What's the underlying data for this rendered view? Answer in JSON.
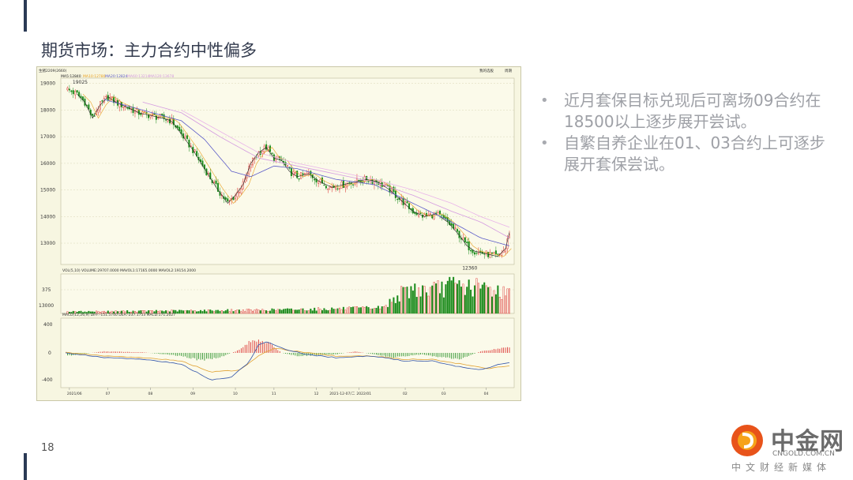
{
  "slide": {
    "title": "期货市场：主力合约中性偏多",
    "page_number": "18",
    "bullets": [
      "近月套保目标兑现后可离场09合约在18500以上逐步展开尝试。",
      "自繁自养企业在01、03合约上可逐步展开套保尝试。"
    ]
  },
  "logo": {
    "name": "中金网",
    "url": "CNGOLD.COM.CN",
    "tagline": "中文财经新媒体"
  },
  "colors": {
    "up": "#d92121",
    "down": "#1a8a1a",
    "ma5": "#222222",
    "ma10": "#e8a020",
    "ma20": "#5b5bc8",
    "ma60": "#d49be0",
    "dif": "#3355aa",
    "dea": "#e0a030"
  },
  "chart_data": [
    {
      "type": "candlestick",
      "header": "生猪2209(2660)",
      "legend": [
        "MA5:12840",
        "MA10:12780",
        "MA20:12824",
        "MA60:13214",
        "MA120:13678"
      ],
      "top_right_labels": [
        "我的选股",
        "周期"
      ],
      "ylim": [
        12200,
        19200
      ],
      "y_ticks": [
        "19000",
        "18000",
        "17000",
        "16000",
        "15000",
        "14000",
        "13000"
      ],
      "annotations": {
        "high": "19025",
        "low": "12360"
      },
      "x_ticks": [
        "2021/06",
        "07",
        "08",
        "09",
        "10",
        "11",
        "12",
        "2021-12-07/二",
        "2022/01",
        "02",
        "03",
        "04"
      ],
      "close_path": [
        [
          0,
          18800
        ],
        [
          6,
          18600
        ],
        [
          10,
          18300
        ],
        [
          14,
          17700
        ],
        [
          18,
          18200
        ],
        [
          22,
          18500
        ],
        [
          26,
          18300
        ],
        [
          32,
          18100
        ],
        [
          38,
          17900
        ],
        [
          44,
          17800
        ],
        [
          50,
          17700
        ],
        [
          55,
          17600
        ],
        [
          60,
          17100
        ],
        [
          66,
          16500
        ],
        [
          72,
          15800
        ],
        [
          78,
          15100
        ],
        [
          84,
          14500
        ],
        [
          88,
          14800
        ],
        [
          92,
          15200
        ],
        [
          96,
          16000
        ],
        [
          100,
          16400
        ],
        [
          104,
          16600
        ],
        [
          108,
          16200
        ],
        [
          112,
          16100
        ],
        [
          116,
          15700
        ],
        [
          120,
          15500
        ],
        [
          126,
          15600
        ],
        [
          132,
          15300
        ],
        [
          138,
          15100
        ],
        [
          144,
          15200
        ],
        [
          150,
          15300
        ],
        [
          156,
          15400
        ],
        [
          162,
          15300
        ],
        [
          168,
          15000
        ],
        [
          174,
          14600
        ],
        [
          180,
          14200
        ],
        [
          186,
          14000
        ],
        [
          192,
          14100
        ],
        [
          198,
          13800
        ],
        [
          204,
          13300
        ],
        [
          208,
          12900
        ],
        [
          212,
          12700
        ],
        [
          218,
          12600
        ],
        [
          224,
          12500
        ],
        [
          228,
          12800
        ],
        [
          230,
          13400
        ]
      ],
      "ma_paths": {
        "ma20": [
          [
            20,
            18400
          ],
          [
            40,
            18000
          ],
          [
            60,
            17600
          ],
          [
            72,
            16900
          ],
          [
            86,
            15700
          ],
          [
            96,
            15500
          ],
          [
            108,
            15900
          ],
          [
            120,
            15800
          ],
          [
            140,
            15400
          ],
          [
            160,
            15200
          ],
          [
            180,
            14500
          ],
          [
            200,
            13800
          ],
          [
            215,
            13200
          ],
          [
            230,
            12900
          ]
        ],
        "ma60": [
          [
            40,
            18300
          ],
          [
            60,
            17900
          ],
          [
            80,
            17000
          ],
          [
            100,
            16200
          ],
          [
            120,
            15900
          ],
          [
            140,
            15600
          ],
          [
            160,
            15300
          ],
          [
            180,
            14800
          ],
          [
            200,
            14200
          ],
          [
            215,
            13800
          ],
          [
            230,
            13200
          ]
        ],
        "ma120": [
          [
            60,
            18000
          ],
          [
            80,
            17200
          ],
          [
            100,
            16400
          ],
          [
            120,
            16000
          ],
          [
            140,
            15700
          ],
          [
            160,
            15400
          ],
          [
            180,
            15000
          ],
          [
            200,
            14500
          ],
          [
            215,
            14000
          ],
          [
            230,
            13600
          ]
        ]
      }
    },
    {
      "type": "bar",
      "header": "VOL(5,10) VOLUME:29707.0000 MAVOL1:17165.0000 MAVOL2:19154.2000",
      "y_ticks": [
        "375",
        "13000"
      ],
      "profile": [
        [
          0,
          0.05
        ],
        [
          100,
          0.1
        ],
        [
          150,
          0.15
        ],
        [
          165,
          0.18
        ],
        [
          172,
          0.55
        ],
        [
          180,
          0.75
        ],
        [
          190,
          0.7
        ],
        [
          200,
          0.85
        ],
        [
          210,
          0.8
        ],
        [
          220,
          0.75
        ],
        [
          230,
          0.6
        ]
      ]
    },
    {
      "type": "bar",
      "header": "MACD(12,26,9) DIFF:-151.5740 DEA:-237.1753 MACD:171.2027",
      "y_ticks": [
        "400",
        "0",
        "-400"
      ],
      "hist_profile": [
        [
          0,
          -0.1
        ],
        [
          20,
          0.05
        ],
        [
          40,
          0.02
        ],
        [
          60,
          -0.1
        ],
        [
          70,
          -0.25
        ],
        [
          80,
          -0.15
        ],
        [
          90,
          0.1
        ],
        [
          95,
          0.35
        ],
        [
          100,
          0.45
        ],
        [
          106,
          0.3
        ],
        [
          112,
          0.0
        ],
        [
          120,
          -0.1
        ],
        [
          140,
          -0.05
        ],
        [
          150,
          0.05
        ],
        [
          160,
          -0.05
        ],
        [
          170,
          -0.15
        ],
        [
          185,
          -0.05
        ],
        [
          195,
          -0.15
        ],
        [
          205,
          -0.2
        ],
        [
          215,
          0.05
        ],
        [
          222,
          0.12
        ],
        [
          230,
          0.2
        ]
      ],
      "dif_profile": [
        [
          0,
          0.0
        ],
        [
          20,
          -0.15
        ],
        [
          40,
          -0.2
        ],
        [
          60,
          -0.35
        ],
        [
          75,
          -0.85
        ],
        [
          85,
          -0.8
        ],
        [
          95,
          -0.3
        ],
        [
          100,
          0.25
        ],
        [
          105,
          0.35
        ],
        [
          112,
          0.15
        ],
        [
          125,
          -0.05
        ],
        [
          140,
          -0.15
        ],
        [
          160,
          -0.1
        ],
        [
          175,
          -0.25
        ],
        [
          190,
          -0.25
        ],
        [
          205,
          -0.45
        ],
        [
          215,
          -0.55
        ],
        [
          225,
          -0.35
        ],
        [
          230,
          -0.3
        ]
      ],
      "dea_profile": [
        [
          0,
          0.02
        ],
        [
          20,
          -0.1
        ],
        [
          40,
          -0.15
        ],
        [
          60,
          -0.25
        ],
        [
          75,
          -0.6
        ],
        [
          90,
          -0.55
        ],
        [
          100,
          -0.1
        ],
        [
          108,
          0.15
        ],
        [
          120,
          0.05
        ],
        [
          140,
          -0.1
        ],
        [
          160,
          -0.1
        ],
        [
          175,
          -0.2
        ],
        [
          190,
          -0.2
        ],
        [
          205,
          -0.35
        ],
        [
          218,
          -0.5
        ],
        [
          230,
          -0.4
        ]
      ]
    }
  ]
}
